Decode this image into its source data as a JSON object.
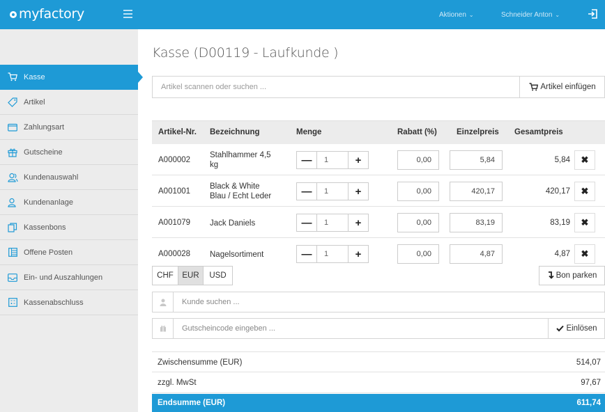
{
  "app": {
    "logo_text": "myfactory",
    "menu_actions": "Aktionen",
    "menu_user": "Schneider Anton"
  },
  "sidebar": {
    "items": [
      {
        "label": "Kasse",
        "icon": "cart-icon"
      },
      {
        "label": "Artikel",
        "icon": "tag-icon"
      },
      {
        "label": "Zahlungsart",
        "icon": "wallet-icon"
      },
      {
        "label": "Gutscheine",
        "icon": "gift-icon"
      },
      {
        "label": "Kundenauswahl",
        "icon": "users-icon"
      },
      {
        "label": "Kundenanlage",
        "icon": "user-add-icon"
      },
      {
        "label": "Kassenbons",
        "icon": "receipts-icon"
      },
      {
        "label": "Offene Posten",
        "icon": "list-icon"
      },
      {
        "label": "Ein- und Auszahlungen",
        "icon": "inbox-icon"
      },
      {
        "label": "Kassenabschluss",
        "icon": "calculator-icon"
      }
    ]
  },
  "main": {
    "title": "Kasse (D00119 - Laufkunde )",
    "search_placeholder": "Artikel scannen oder suchen ...",
    "insert_button": "Artikel einfügen",
    "table": {
      "headers": {
        "art": "Artikel-Nr.",
        "name": "Bezeichnung",
        "qty": "Menge",
        "rabatt": "Rabatt (%)",
        "ep": "Einzelpreis",
        "gp": "Gesamtpreis"
      },
      "rows": [
        {
          "art": "A000002",
          "name": "Stahlhammer 4,5 kg",
          "qty": "1",
          "rabatt": "0,00",
          "ep": "5,84",
          "gp": "5,84"
        },
        {
          "art": "A001001",
          "name": "Black & White Blau / Echt Leder",
          "qty": "1",
          "rabatt": "0,00",
          "ep": "420,17",
          "gp": "420,17"
        },
        {
          "art": "A001079",
          "name": "Jack Daniels",
          "qty": "1",
          "rabatt": "0,00",
          "ep": "83,19",
          "gp": "83,19"
        },
        {
          "art": "A000028",
          "name": "Nagelsortiment",
          "qty": "1",
          "rabatt": "0,00",
          "ep": "4,87",
          "gp": "4,87"
        }
      ]
    },
    "currencies": [
      "CHF",
      "EUR",
      "USD"
    ],
    "active_currency": "EUR",
    "park_button": "Bon parken",
    "customer_placeholder": "Kunde suchen ...",
    "voucher_placeholder": "Gutscheincode eingeben ...",
    "redeem_button": "Einlösen",
    "summary": {
      "subtotal_label": "Zwischensumme (EUR)",
      "subtotal_value": "514,07",
      "tax_label": "zzgl. MwSt",
      "tax_value": "97,67",
      "total_label": "Endsumme (EUR)",
      "total_value": "611,74"
    }
  },
  "colors": {
    "accent": "#1e9ad6",
    "sidebar_bg": "#ececec",
    "header_bg": "#ececec"
  }
}
